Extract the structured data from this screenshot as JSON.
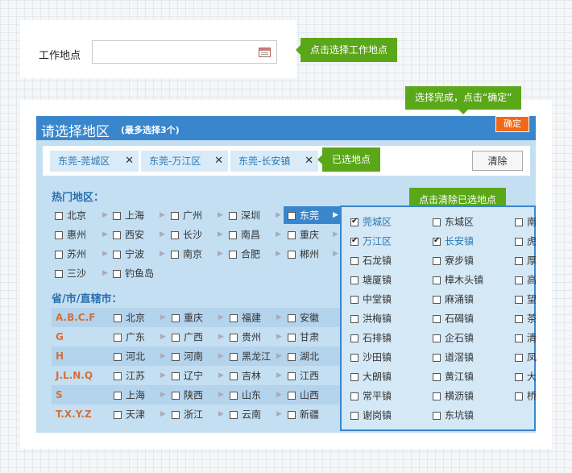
{
  "top": {
    "label": "工作地点",
    "input_value": "",
    "tip": "点击选择工作地点"
  },
  "tips": {
    "done": "选择完成，点击“确定”",
    "selected": "已选地点",
    "clear": "点击清除已选地点"
  },
  "panel": {
    "title": "请选择地区",
    "subtitle": "(最多选择3个)",
    "confirm": "确定",
    "clear_button": "清除",
    "tags": [
      "东莞-莞城区",
      "东莞-万江区",
      "东莞-长安镇"
    ]
  },
  "hot": {
    "heading": "热门地区：",
    "rows": [
      [
        "北京",
        "上海",
        "广州",
        "深圳",
        "东莞"
      ],
      [
        "惠州",
        "西安",
        "长沙",
        "南昌",
        "重庆"
      ],
      [
        "苏州",
        "宁波",
        "南京",
        "合肥",
        "郴州"
      ],
      [
        "三沙",
        "钓鱼岛"
      ]
    ]
  },
  "province": {
    "heading": "省/市/直辖市：",
    "rows": [
      {
        "label": "A.B.C.F",
        "items": [
          "北京",
          "重庆",
          "福建",
          "安徽"
        ]
      },
      {
        "label": "G",
        "items": [
          "广东",
          "广西",
          "贵州",
          "甘肃"
        ]
      },
      {
        "label": "H",
        "items": [
          "河北",
          "河南",
          "黑龙江",
          "湖北"
        ]
      },
      {
        "label": "J.L.N.Q",
        "items": [
          "江苏",
          "辽宁",
          "吉林",
          "江西"
        ]
      },
      {
        "label": "S",
        "items": [
          "上海",
          "陕西",
          "山东",
          "山西"
        ]
      },
      {
        "label": "T.X.Y.Z",
        "items": [
          "天津",
          "浙江",
          "云南",
          "新疆"
        ]
      }
    ]
  },
  "sub": {
    "col1": [
      {
        "label": "莞城区",
        "checked": true
      },
      {
        "label": "万江区",
        "checked": true
      },
      {
        "label": "石龙镇",
        "checked": false
      },
      {
        "label": "塘厦镇",
        "checked": false
      },
      {
        "label": "中堂镇",
        "checked": false
      },
      {
        "label": "洪梅镇",
        "checked": false
      },
      {
        "label": "石排镇",
        "checked": false
      },
      {
        "label": "沙田镇",
        "checked": false
      },
      {
        "label": "大朗镇",
        "checked": false
      },
      {
        "label": "常平镇",
        "checked": false
      },
      {
        "label": "谢岗镇",
        "checked": false
      }
    ],
    "col2": [
      {
        "label": "东城区",
        "checked": false
      },
      {
        "label": "长安镇",
        "checked": true
      },
      {
        "label": "寮步镇",
        "checked": false
      },
      {
        "label": "樟木头镇",
        "checked": false
      },
      {
        "label": "麻涌镇",
        "checked": false
      },
      {
        "label": "石碣镇",
        "checked": false
      },
      {
        "label": "企石镇",
        "checked": false
      },
      {
        "label": "道滘镇",
        "checked": false
      },
      {
        "label": "黄江镇",
        "checked": false
      },
      {
        "label": "横沥镇",
        "checked": false
      },
      {
        "label": "东坑镇",
        "checked": false
      }
    ],
    "col3": [
      "南",
      "虎",
      "厚",
      "高",
      "望",
      "茶",
      "清",
      "凤",
      "大",
      "桥"
    ]
  },
  "colors": {
    "title_bar": "#3a86cc",
    "panel_bg": "#c5dff2",
    "accent_orange": "#f0691a",
    "tip_green": "#5aa71a",
    "checked_text": "#2b78b5"
  }
}
